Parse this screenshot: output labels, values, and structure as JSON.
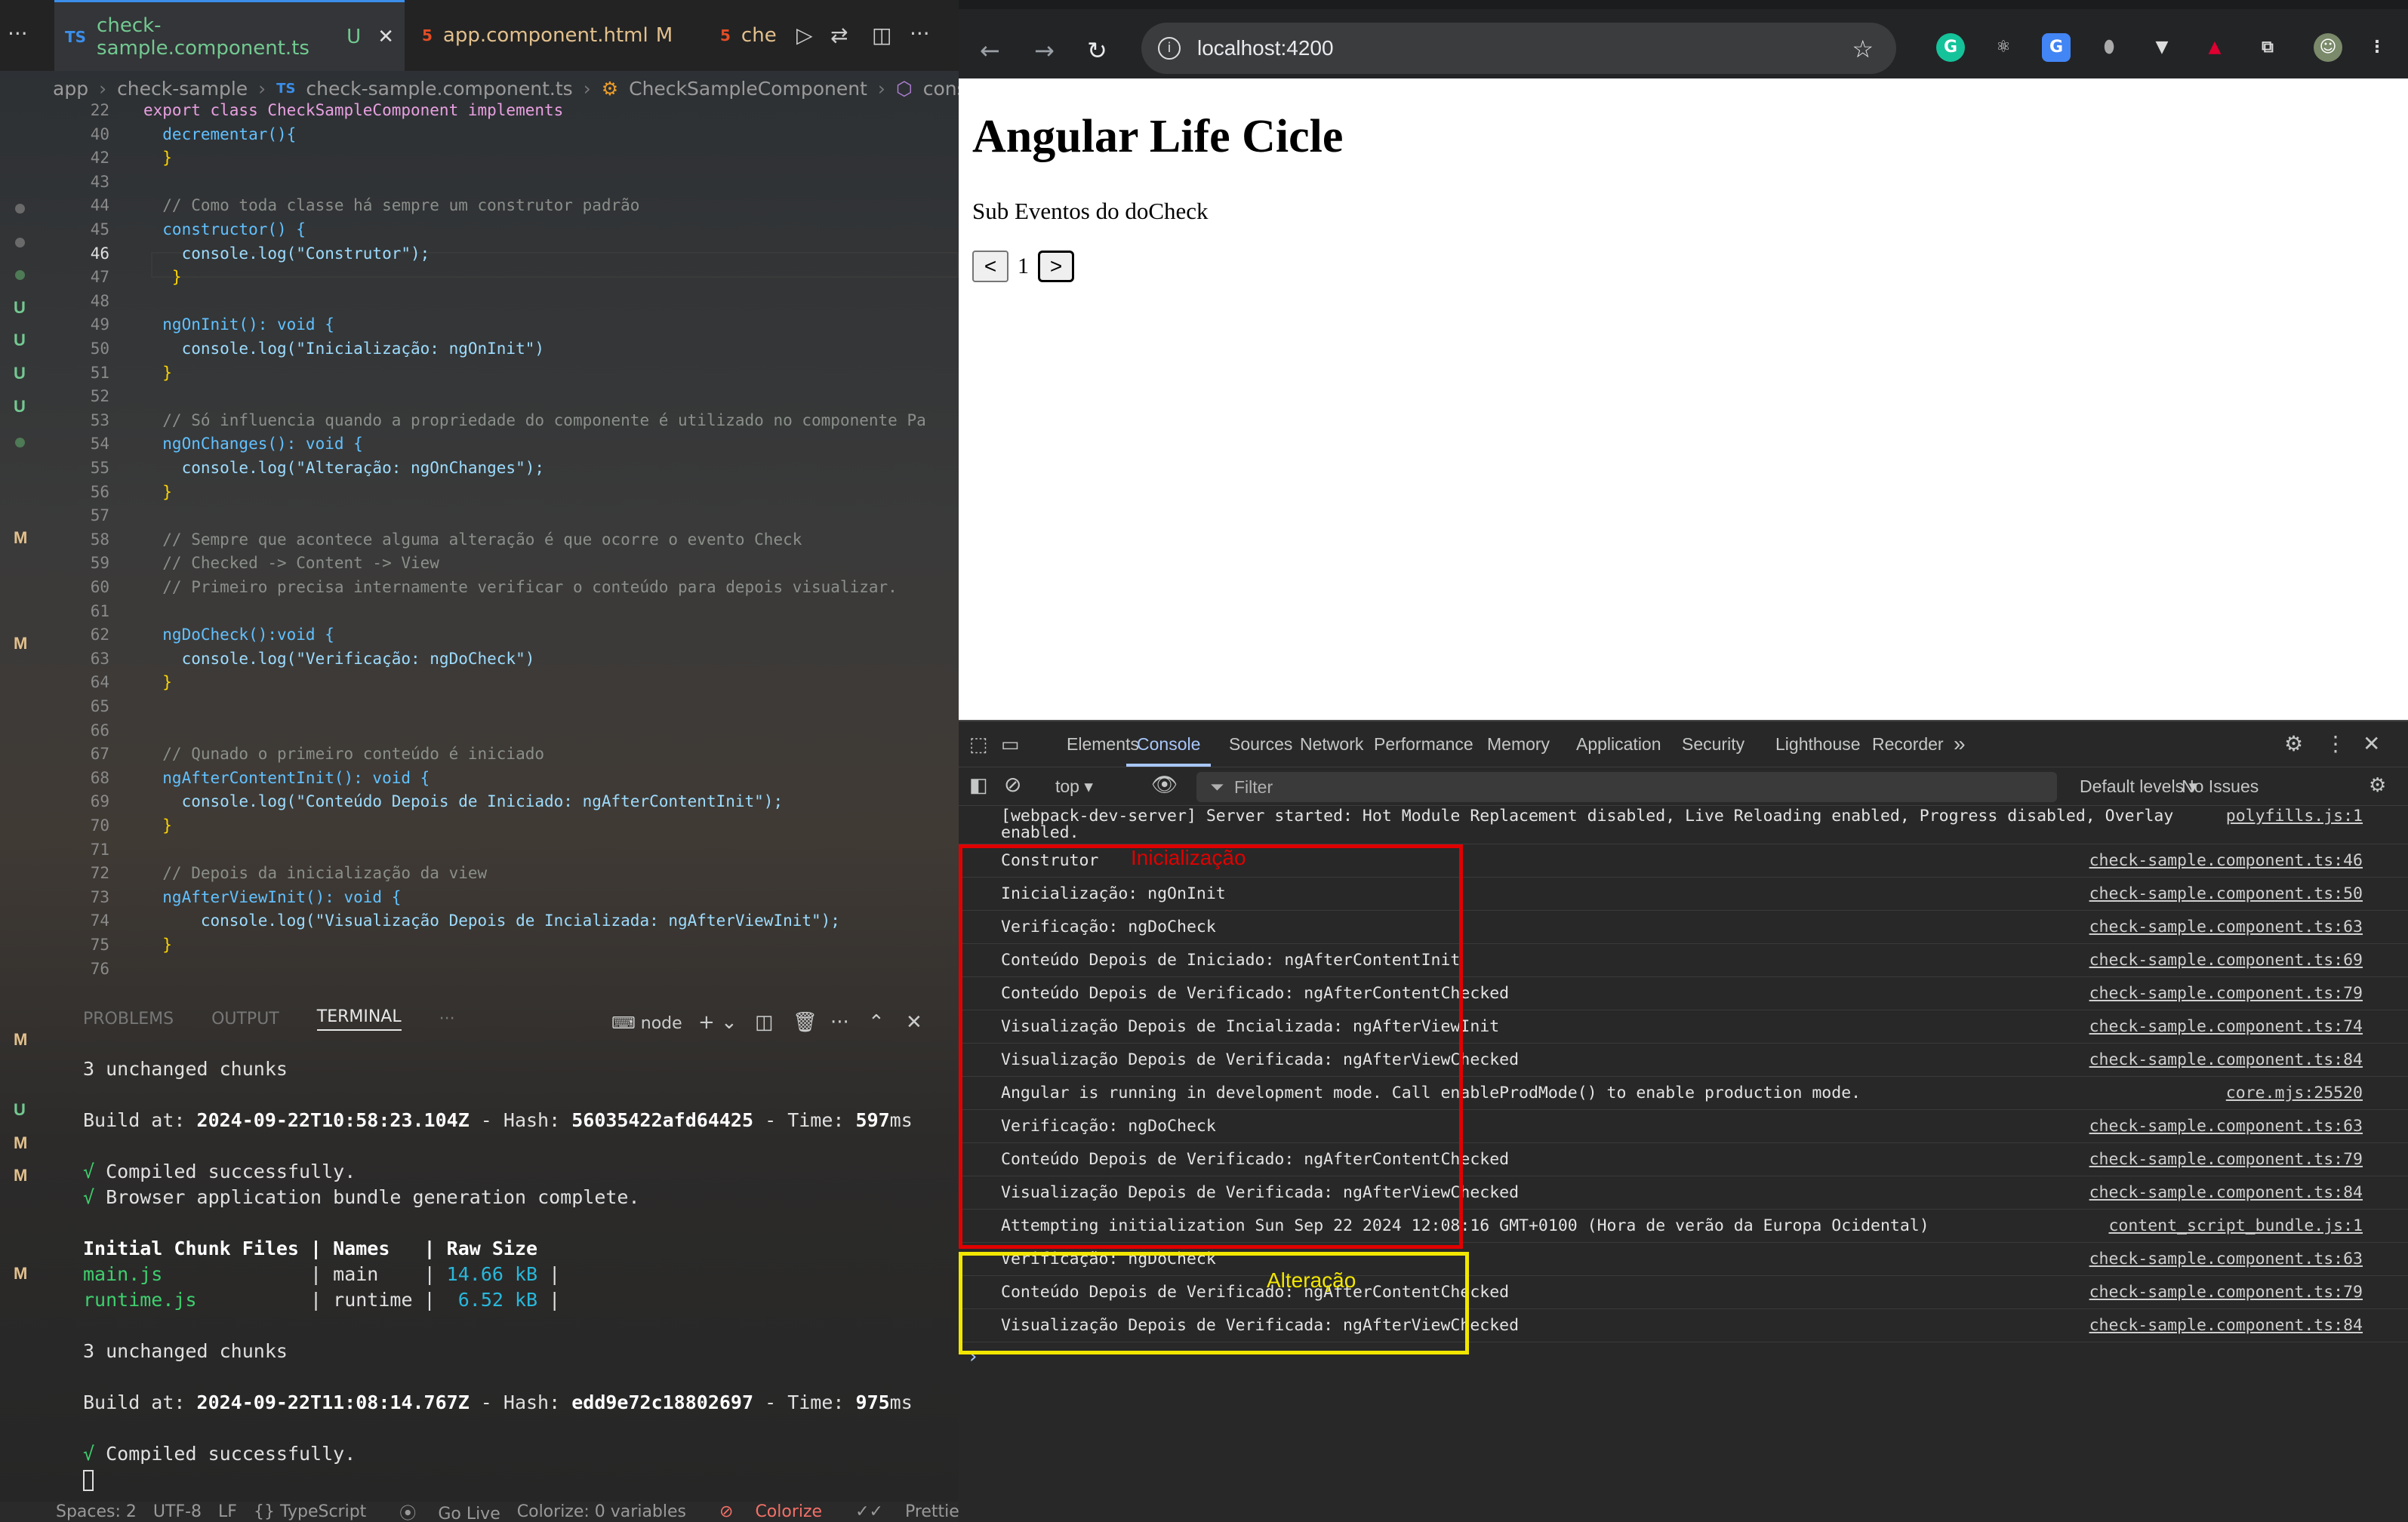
{
  "vscode": {
    "tabs": [
      {
        "label": "check-sample.component.ts",
        "badge": "U",
        "icon": "TS"
      },
      {
        "label": "app.component.html",
        "badge": "M",
        "icon": "5"
      },
      {
        "label": "che",
        "badge": "",
        "icon": "5"
      }
    ],
    "breadcrumb": [
      "app",
      "check-sample",
      "check-sample.component.ts",
      "CheckSampleComponent",
      "constructor"
    ],
    "code_lines": [
      {
        "n": "22",
        "t": "export class CheckSampleComponent implements"
      },
      {
        "n": "40",
        "t": "  decrementar(){"
      },
      {
        "n": "42",
        "t": "  }"
      },
      {
        "n": "43",
        "t": ""
      },
      {
        "n": "44",
        "t": "  // Como toda classe há sempre um construtor padrão"
      },
      {
        "n": "45",
        "t": "  constructor() {"
      },
      {
        "n": "46",
        "t": "    console.log(\"Construtor\");"
      },
      {
        "n": "47",
        "t": "   }"
      },
      {
        "n": "48",
        "t": ""
      },
      {
        "n": "49",
        "t": "  ngOnInit(): void {"
      },
      {
        "n": "50",
        "t": "    console.log(\"Inicialização: ngOnInit\")"
      },
      {
        "n": "51",
        "t": "  }"
      },
      {
        "n": "52",
        "t": ""
      },
      {
        "n": "53",
        "t": "  // Só influencia quando a propriedade do componente é utilizado no componente Pa"
      },
      {
        "n": "54",
        "t": "  ngOnChanges(): void {"
      },
      {
        "n": "55",
        "t": "    console.log(\"Alteração: ngOnChanges\");"
      },
      {
        "n": "56",
        "t": "  }"
      },
      {
        "n": "57",
        "t": ""
      },
      {
        "n": "58",
        "t": "  // Sempre que acontece alguma alteração é que ocorre o evento Check"
      },
      {
        "n": "59",
        "t": "  // Checked -> Content -> View"
      },
      {
        "n": "60",
        "t": "  // Primeiro precisa internamente verificar o conteúdo para depois visualizar."
      },
      {
        "n": "61",
        "t": ""
      },
      {
        "n": "62",
        "t": "  ngDoCheck():void {"
      },
      {
        "n": "63",
        "t": "    console.log(\"Verificação: ngDoCheck\")"
      },
      {
        "n": "64",
        "t": "  }"
      },
      {
        "n": "65",
        "t": ""
      },
      {
        "n": "66",
        "t": ""
      },
      {
        "n": "67",
        "t": "  // Qunado o primeiro conteúdo é iniciado"
      },
      {
        "n": "68",
        "t": "  ngAfterContentInit(): void {"
      },
      {
        "n": "69",
        "t": "    console.log(\"Conteúdo Depois de Iniciado: ngAfterContentInit\");"
      },
      {
        "n": "70",
        "t": "  }"
      },
      {
        "n": "71",
        "t": ""
      },
      {
        "n": "72",
        "t": "  // Depois da inicialização da view"
      },
      {
        "n": "73",
        "t": "  ngAfterViewInit(): void {"
      },
      {
        "n": "74",
        "t": "      console.log(\"Visualização Depois de Incializada: ngAfterViewInit\");"
      },
      {
        "n": "75",
        "t": "  }"
      },
      {
        "n": "76",
        "t": ""
      }
    ],
    "panel_tabs": [
      "PROBLEMS",
      "OUTPUT",
      "TERMINAL",
      "···"
    ],
    "terminal_shell": "node",
    "terminal": {
      "l1": "3 unchanged chunks",
      "build1_date": "2024-09-22T10:58:23.104Z",
      "build1_hash": "56035422afd64425",
      "build1_time": "597",
      "compiled": "Compiled successfully.",
      "bundle": "Browser application bundle generation complete.",
      "table_header": "Initial Chunk Files | Names   | Raw Size",
      "row1_file": "main.js",
      "row1_name": "main",
      "row1_size": "14.66 kB",
      "row2_file": "runtime.js",
      "row2_name": "runtime",
      "row2_size": "6.52 kB",
      "l2": "3 unchanged chunks",
      "build2_date": "2024-09-22T11:08:14.767Z",
      "build2_hash": "edd9e72c18802697",
      "build2_time": "975",
      "compiled2": "Compiled successfully."
    },
    "status": [
      "Spaces: 2",
      "UTF-8",
      "LF",
      "{} TypeScript",
      "Go Live",
      "Colorize: 0 variables",
      "Colorize",
      "Prettier"
    ]
  },
  "browser": {
    "url": "localhost:4200",
    "page": {
      "title": "Angular Life Cicle",
      "subtitle": "Sub Eventos do doCheck",
      "prev": "<",
      "count": "1",
      "next": ">"
    },
    "devtools_tabs": [
      "Elements",
      "Console",
      "Sources",
      "Network",
      "Performance",
      "Memory",
      "Application",
      "Security",
      "Lighthouse",
      "Recorder"
    ],
    "context": "top",
    "filter_placeholder": "Filter",
    "levels": "Default levels",
    "issues": "No Issues",
    "console": [
      {
        "msg": "[webpack-dev-server] Server started: Hot Module Replacement disabled, Live Reloading enabled, Progress disabled, Overlay",
        "msg2": "enabled.",
        "src": "polyfills.js:1"
      },
      {
        "msg": "Construtor",
        "src": "check-sample.component.ts:46"
      },
      {
        "msg": "Inicialização: ngOnInit",
        "src": "check-sample.component.ts:50"
      },
      {
        "msg": "Verificação: ngDoCheck",
        "src": "check-sample.component.ts:63"
      },
      {
        "msg": "Conteúdo Depois de Iniciado: ngAfterContentInit",
        "src": "check-sample.component.ts:69"
      },
      {
        "msg": "Conteúdo Depois de Verificado: ngAfterContentChecked",
        "src": "check-sample.component.ts:79"
      },
      {
        "msg": "Visualização Depois de Incializada: ngAfterViewInit",
        "src": "check-sample.component.ts:74"
      },
      {
        "msg": "Visualização Depois de Verificada: ngAfterViewChecked",
        "src": "check-sample.component.ts:84"
      },
      {
        "msg": "Angular is running in development mode. Call enableProdMode() to enable production mode.",
        "src": "core.mjs:25520"
      },
      {
        "msg": "Verificação: ngDoCheck",
        "src": "check-sample.component.ts:63"
      },
      {
        "msg": "Conteúdo Depois de Verificado: ngAfterContentChecked",
        "src": "check-sample.component.ts:79"
      },
      {
        "msg": "Visualização Depois de Verificada: ngAfterViewChecked",
        "src": "check-sample.component.ts:84"
      },
      {
        "msg": "Attempting initialization Sun Sep 22 2024 12:08:16 GMT+0100 (Hora de verão da Europa Ocidental)",
        "src": "content_script_bundle.js:1"
      },
      {
        "msg": "Verificação: ngDoCheck",
        "src": "check-sample.component.ts:63"
      },
      {
        "msg": "Conteúdo Depois de Verificado: ngAfterContentChecked",
        "src": "check-sample.component.ts:79"
      },
      {
        "msg": "Visualização Depois de Verificada: ngAfterViewChecked",
        "src": "check-sample.component.ts:84"
      }
    ],
    "annotations": {
      "init_label": "Inicialização",
      "init_color": "#e00000",
      "change_label": "Alteração",
      "change_color": "#f2e600"
    },
    "prompt": "›"
  }
}
